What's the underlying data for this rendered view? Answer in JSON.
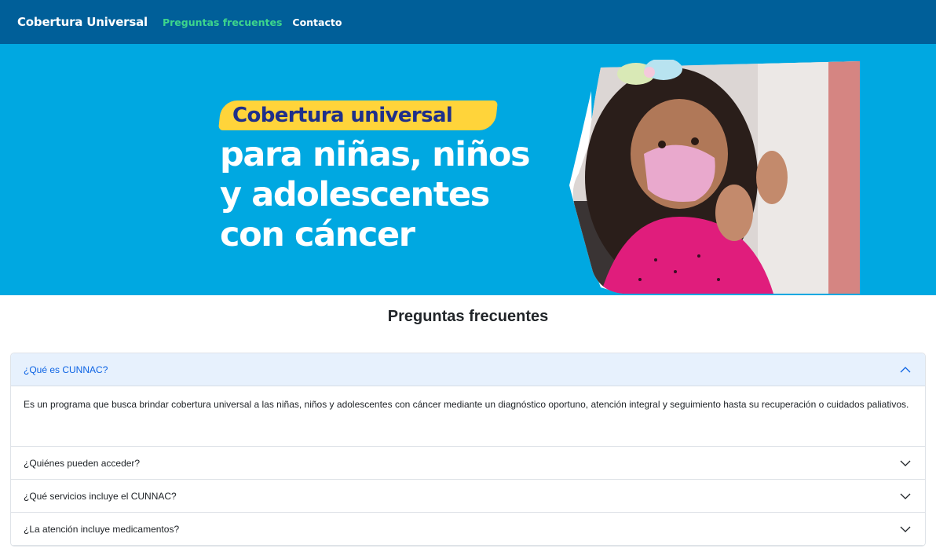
{
  "navbar": {
    "brand": "Cobertura Universal",
    "links": [
      "Preguntas frecuentes",
      "Contacto"
    ]
  },
  "hero": {
    "tag": "Cobertura universal",
    "headline": [
      "para niñas, niños",
      "y adolescentes",
      "con cáncer"
    ]
  },
  "faq": {
    "title": "Preguntas frecuentes",
    "items": [
      {
        "question": "¿Qué es CUNNAC?",
        "answer": "Es un programa que busca brindar cobertura universal a las niñas, niños y adolescentes con cáncer mediante un diagnóstico oportuno, atención integral y seguimiento hasta su recuperación o cuidados paliativos.",
        "expanded": true
      },
      {
        "question": "¿Quiénes pueden acceder?",
        "expanded": false
      },
      {
        "question": "¿Qué servicios incluye el CUNNAC?",
        "expanded": false
      },
      {
        "question": "¿La atención incluye medicamentos?",
        "expanded": false
      }
    ]
  },
  "colors": {
    "navbar_bg": "#005f99",
    "hero_bg": "#00a8e1",
    "active_link": "#3dd68c",
    "tag_bg": "#ffd43a",
    "open_header_bg": "#e7f1fd",
    "open_header_text": "#0c63e4"
  },
  "icons": [
    "chevron-up-icon",
    "chevron-down-icon"
  ]
}
